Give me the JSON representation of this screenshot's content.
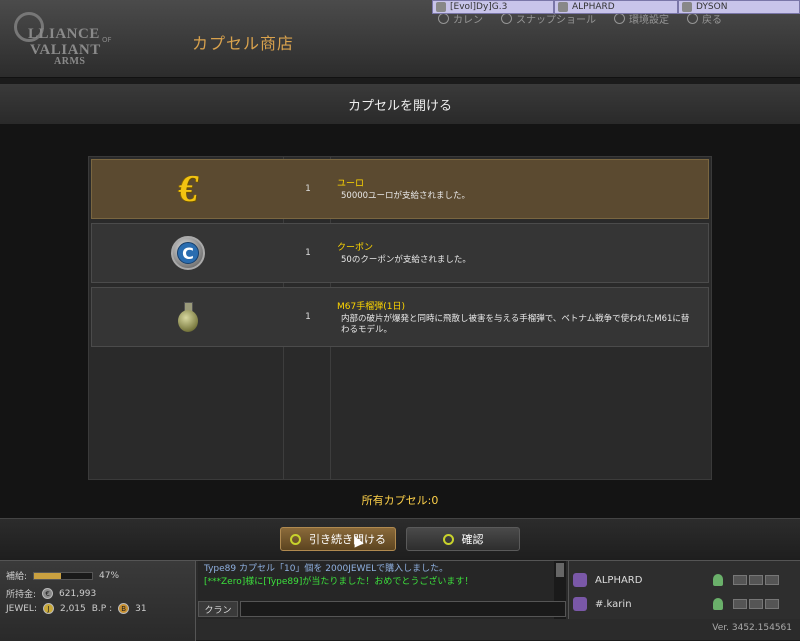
{
  "header": {
    "logo_line1": "LLIANCE",
    "logo_line2": "VALIANT",
    "logo_line3": "ARMS",
    "logo_of": "OF",
    "page_title": "カプセル商店",
    "nav": [
      "カレン",
      "スナップショール",
      "環境設定",
      "戻る"
    ],
    "players": [
      "[Evol]Dy]G.3",
      "ALPHARD",
      "DYSON"
    ]
  },
  "subheader": {
    "title": "カプセルを開ける"
  },
  "items": [
    {
      "icon": "euro-icon",
      "qty": "1",
      "name": "ユーロ",
      "desc": "50000ユーロが支給されました。"
    },
    {
      "icon": "coupon-icon",
      "qty": "1",
      "name": "クーポン",
      "desc": "50のクーポンが支給されました。"
    },
    {
      "icon": "grenade-icon",
      "qty": "1",
      "name": "M67手榴弾(1日)",
      "desc": "内部の破片が爆発と同時に飛散し被害を与える手榴弾で、ベトナム戦争で使われたM61に替わるモデル。"
    }
  ],
  "capsule_count": "所有カプセル:0",
  "buttons": {
    "continue": "引き続き開ける",
    "confirm": "確認"
  },
  "status": {
    "supply_label": "補給:",
    "supply_percent": "47%",
    "supply_fraction": 0.47,
    "money_label": "所持金:",
    "money_coin": "€",
    "money_value": "621,993",
    "jewel_label": "JEWEL:",
    "jewel_coin": "J",
    "jewel_value": "2,015",
    "bp_label": "B.P :",
    "bp_coin": "B",
    "bp_value": "31"
  },
  "chat": {
    "message1": "Type89 カプセル「10」個を 2000JEWELで購入しました。",
    "message2": "[***Zero]様に[Type89]が当たりました！おめでとうございます！",
    "clan_tab": "クラン",
    "input_value": ""
  },
  "friends": [
    "ALPHARD",
    "#.karin"
  ],
  "version": "Ver. 3452.154561",
  "colors": {
    "accent": "#d9a24d",
    "selected_row": "#5b4a30",
    "item_name": "#ffd700"
  }
}
